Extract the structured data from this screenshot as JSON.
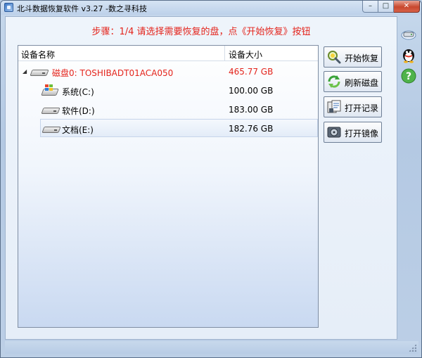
{
  "window": {
    "title": "北斗数据恢复软件 v3.27 -数之寻科技",
    "minimize_glyph": "–",
    "maximize_glyph": "□",
    "close_glyph": "✕"
  },
  "step_text": "步骤：1/4 请选择需要恢复的盘，点《开始恢复》按钮",
  "columns": {
    "name": "设备名称",
    "size": "设备大小"
  },
  "disk": {
    "expander": "◢",
    "label": "磁盘0: TOSHIBADT01ACA050",
    "size": "465.77 GB",
    "icon": "hard-drive-icon"
  },
  "partitions": [
    {
      "label": "系统(C:)",
      "size": "100.00 GB",
      "icon": "windows-drive-icon"
    },
    {
      "label": "软件(D:)",
      "size": "183.00 GB",
      "icon": "hard-drive-icon"
    },
    {
      "label": "文档(E:)",
      "size": "182.76 GB",
      "icon": "hard-drive-icon",
      "selected": true
    }
  ],
  "buttons": [
    {
      "label": "开始恢复",
      "icon": "start-recovery-icon"
    },
    {
      "label": "刷新磁盘",
      "icon": "refresh-icon"
    },
    {
      "label": "打开记录",
      "icon": "open-record-icon"
    },
    {
      "label": "打开镜像",
      "icon": "open-image-icon"
    }
  ],
  "side_buttons": [
    {
      "icon": "network-drive-icon"
    },
    {
      "icon": "qq-icon"
    },
    {
      "icon": "help-icon"
    }
  ],
  "colors": {
    "accent_red": "#e4241c",
    "selection": "#e3ecf8"
  }
}
